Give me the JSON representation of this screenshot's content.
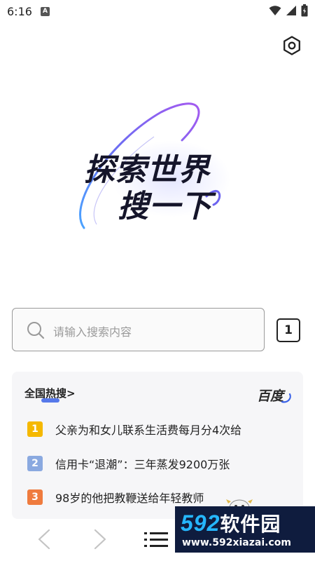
{
  "status_bar": {
    "time": "6:16",
    "notification_badge": "A",
    "icons": [
      "wifi-icon",
      "signal-icon",
      "battery-icon"
    ]
  },
  "hero": {
    "line1": "探索世界",
    "line2": "搜一下",
    "colors": {
      "text": "#15152a",
      "orbit_start": "#5b6cf0",
      "orbit_end": "#9a5cf5"
    }
  },
  "search": {
    "placeholder": "请输入搜索内容",
    "tab_count": "1"
  },
  "hot_search": {
    "title": "全国热搜>",
    "brand": "百度",
    "items": [
      {
        "rank": "1",
        "text": "父亲为和女儿联系生活费每月分4次给",
        "color": "#f5b800"
      },
      {
        "rank": "2",
        "text": "信用卡“退潮”：三年蒸发9200万张",
        "color": "#8aa9e0"
      },
      {
        "rank": "3",
        "text": "98岁的他把教鞭送给年轻教师",
        "color": "#ef7b3e"
      }
    ]
  },
  "bottom_nav": {
    "icons": [
      "back-icon",
      "forward-icon",
      "menu-icon"
    ]
  },
  "watermark": {
    "brand_number": "592",
    "brand_cn": "软件园",
    "url": "www.592xiazai.com"
  }
}
